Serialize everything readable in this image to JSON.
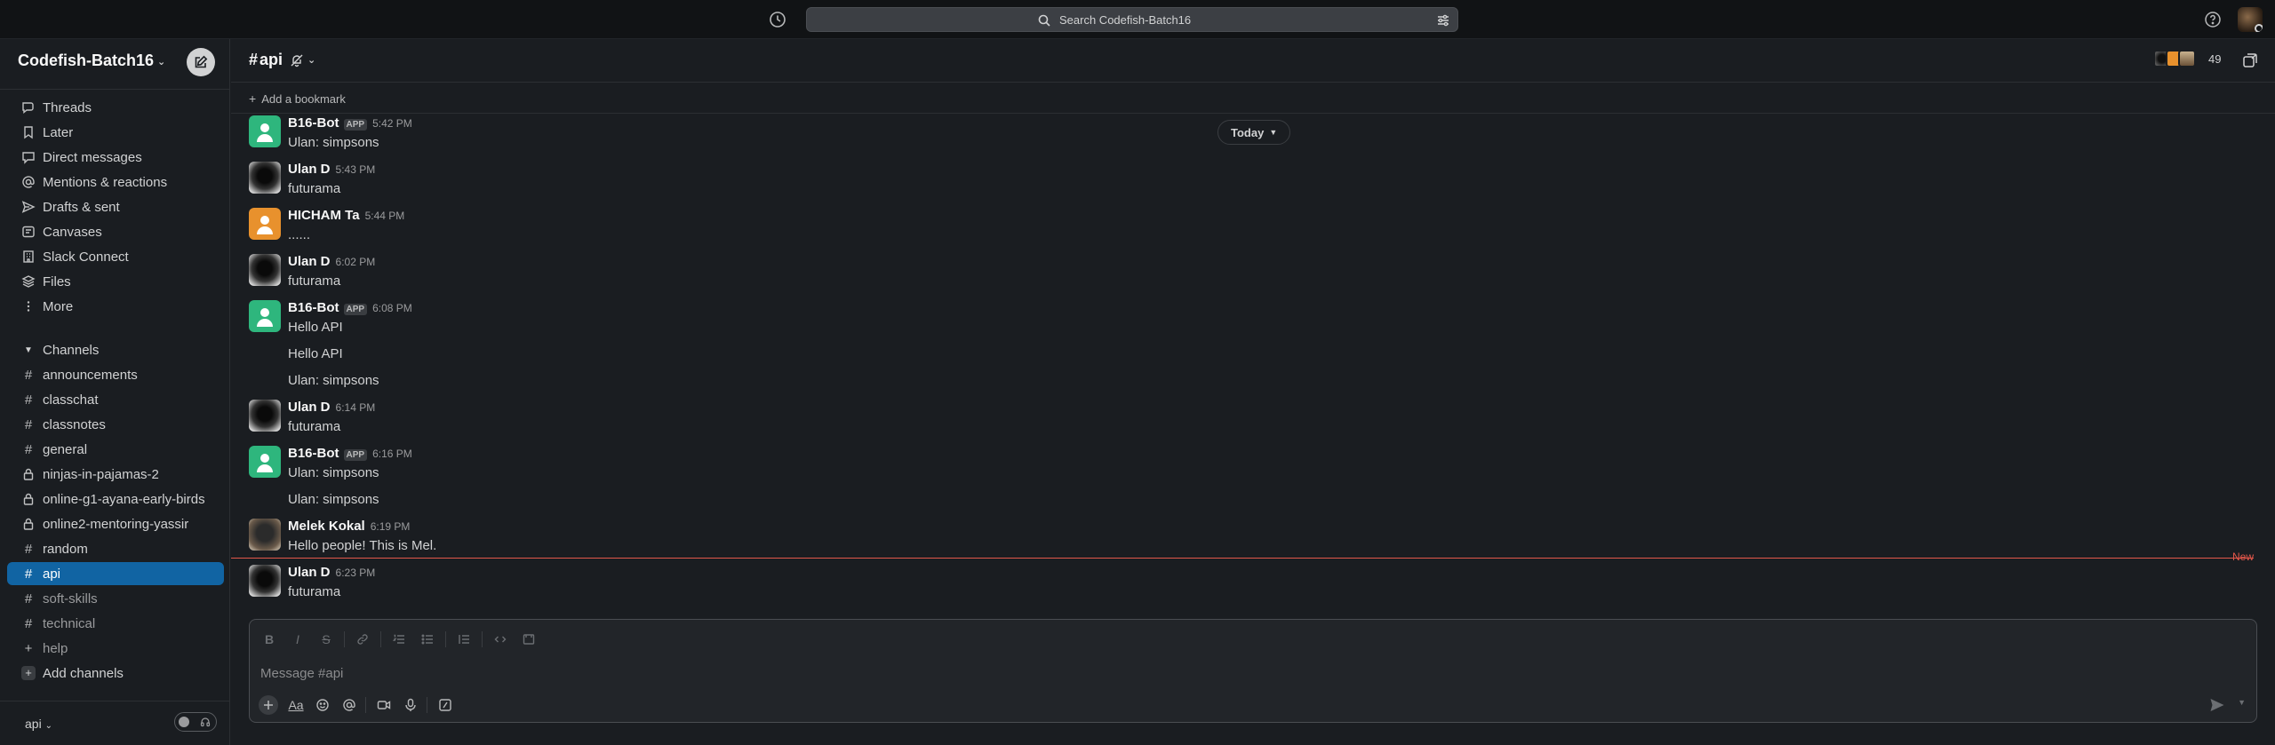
{
  "topbar": {
    "search_placeholder": "Search Codefish-Batch16",
    "icons": [
      "history-icon",
      "search-icon",
      "filter-icon",
      "help-icon",
      "user-avatar"
    ]
  },
  "workspace": {
    "name": "Codefish-Batch16"
  },
  "sidebar": {
    "nav": [
      {
        "label": "Threads",
        "icon": "threads-icon"
      },
      {
        "label": "Later",
        "icon": "bookmark-icon"
      },
      {
        "label": "Direct messages",
        "icon": "dm-icon"
      },
      {
        "label": "Mentions & reactions",
        "icon": "at-icon"
      },
      {
        "label": "Drafts & sent",
        "icon": "send-icon"
      },
      {
        "label": "Canvases",
        "icon": "canvas-icon"
      },
      {
        "label": "Slack Connect",
        "icon": "building-icon"
      },
      {
        "label": "Files",
        "icon": "files-icon"
      },
      {
        "label": "More",
        "icon": "more-icon"
      }
    ],
    "channels_header": "Channels",
    "channels": [
      {
        "label": "announcements",
        "type": "public"
      },
      {
        "label": "classchat",
        "type": "public"
      },
      {
        "label": "classnotes",
        "type": "public"
      },
      {
        "label": "general",
        "type": "public"
      },
      {
        "label": "ninjas-in-pajamas-2",
        "type": "private"
      },
      {
        "label": "online-g1-ayana-early-birds",
        "type": "private"
      },
      {
        "label": "online2-mentoring-yassir",
        "type": "private"
      },
      {
        "label": "random",
        "type": "public"
      },
      {
        "label": "api",
        "type": "public",
        "active": true
      },
      {
        "label": "soft-skills",
        "type": "public",
        "muted": true
      },
      {
        "label": "technical",
        "type": "public",
        "muted": true
      },
      {
        "label": "help",
        "type": "plus",
        "muted": true
      }
    ],
    "add_channels": "Add channels",
    "footer_channel": "api"
  },
  "channel": {
    "name": "api",
    "member_count": "49",
    "bookmark_label": "Add a bookmark"
  },
  "today_label": "Today",
  "new_label": "New",
  "messages": [
    {
      "name": "B16-Bot",
      "app": "APP",
      "time": "5:42 PM",
      "lines": [
        "Ulan: simpsons"
      ],
      "avatar": "bot"
    },
    {
      "name": "Ulan D",
      "time": "5:43 PM",
      "lines": [
        "futurama"
      ],
      "avatar": "ulan"
    },
    {
      "name": "HICHAM Ta",
      "time": "5:44 PM",
      "lines": [
        "......"
      ],
      "avatar": "hicham"
    },
    {
      "name": "Ulan D",
      "time": "6:02 PM",
      "lines": [
        "futurama"
      ],
      "avatar": "ulan"
    },
    {
      "name": "B16-Bot",
      "app": "APP",
      "time": "6:08 PM",
      "lines": [
        "Hello API",
        "Hello API",
        "Ulan: simpsons"
      ],
      "avatar": "bot"
    },
    {
      "name": "Ulan D",
      "time": "6:14 PM",
      "lines": [
        "futurama"
      ],
      "avatar": "ulan"
    },
    {
      "name": "B16-Bot",
      "app": "APP",
      "time": "6:16 PM",
      "lines": [
        "Ulan: simpsons",
        "Ulan: simpsons"
      ],
      "avatar": "bot"
    },
    {
      "name": "Melek Kokal",
      "time": "6:19 PM",
      "lines": [
        "Hello people! This is Mel."
      ],
      "avatar": "melek"
    },
    {
      "name": "Ulan D",
      "time": "6:23 PM",
      "lines": [
        "futurama"
      ],
      "avatar": "ulan"
    }
  ],
  "composer": {
    "placeholder": "Message #api",
    "format_buttons": [
      "B",
      "I",
      "S"
    ]
  },
  "colors": {
    "active_channel": "#1164a3",
    "bot_avatar": "#2eb67d",
    "new_divider": "#e3574a",
    "background": "#1a1d21"
  }
}
